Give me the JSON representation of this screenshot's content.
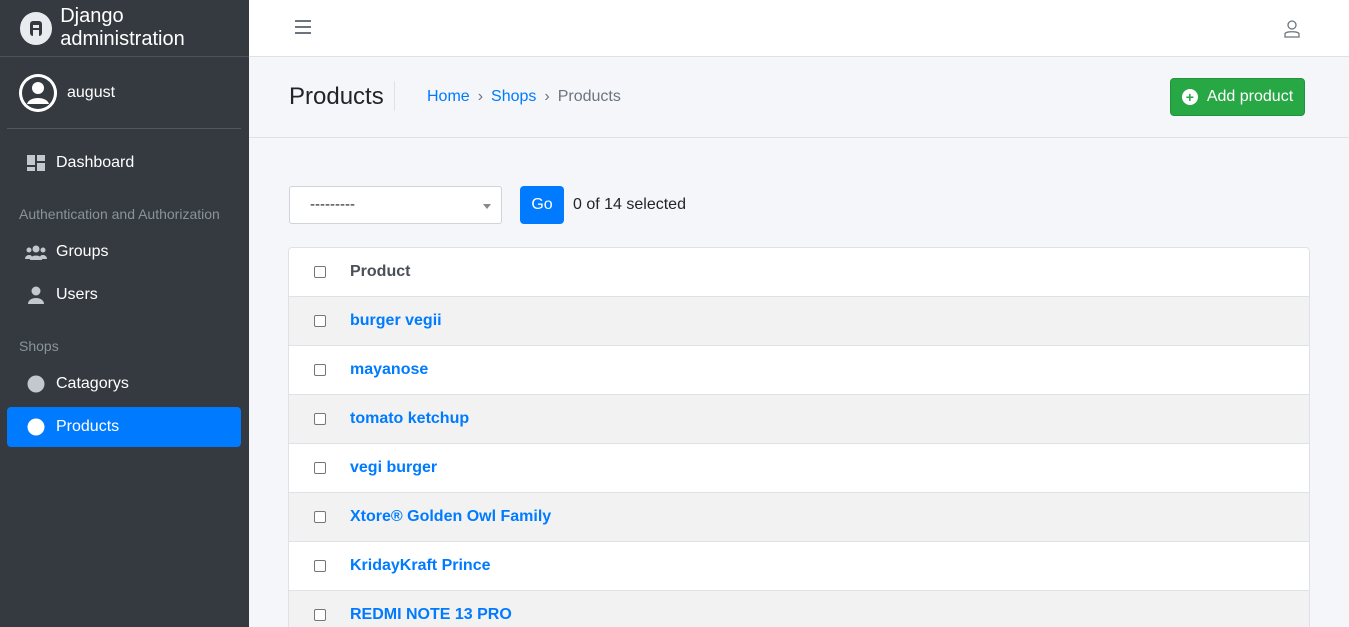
{
  "brand": {
    "title": "Django administration"
  },
  "user": {
    "name": "august"
  },
  "sidebar": {
    "dashboard": "Dashboard",
    "sections": [
      {
        "header": "Authentication and Authorization",
        "items": [
          "Groups",
          "Users"
        ]
      },
      {
        "header": "Shops",
        "items": [
          "Catagorys",
          "Products"
        ]
      }
    ]
  },
  "header": {
    "title": "Products",
    "breadcrumb": [
      "Home",
      "Shops",
      "Products"
    ],
    "breadcrumb_sep": "›",
    "add_label": "Add product"
  },
  "actions": {
    "select_value": "---------",
    "go_label": "Go",
    "selected_text": "0 of 14 selected"
  },
  "table": {
    "column": "Product",
    "rows": [
      "burger vegii",
      "mayanose",
      "tomato ketchup",
      "vegi burger",
      "Xtore® Golden Owl Family",
      "KridayKraft Prince",
      "REDMI NOTE 13 PRO"
    ]
  },
  "colors": {
    "sidebar_bg": "#343a40",
    "active": "#007bff",
    "add_button": "#28a745",
    "link": "#007bff"
  }
}
